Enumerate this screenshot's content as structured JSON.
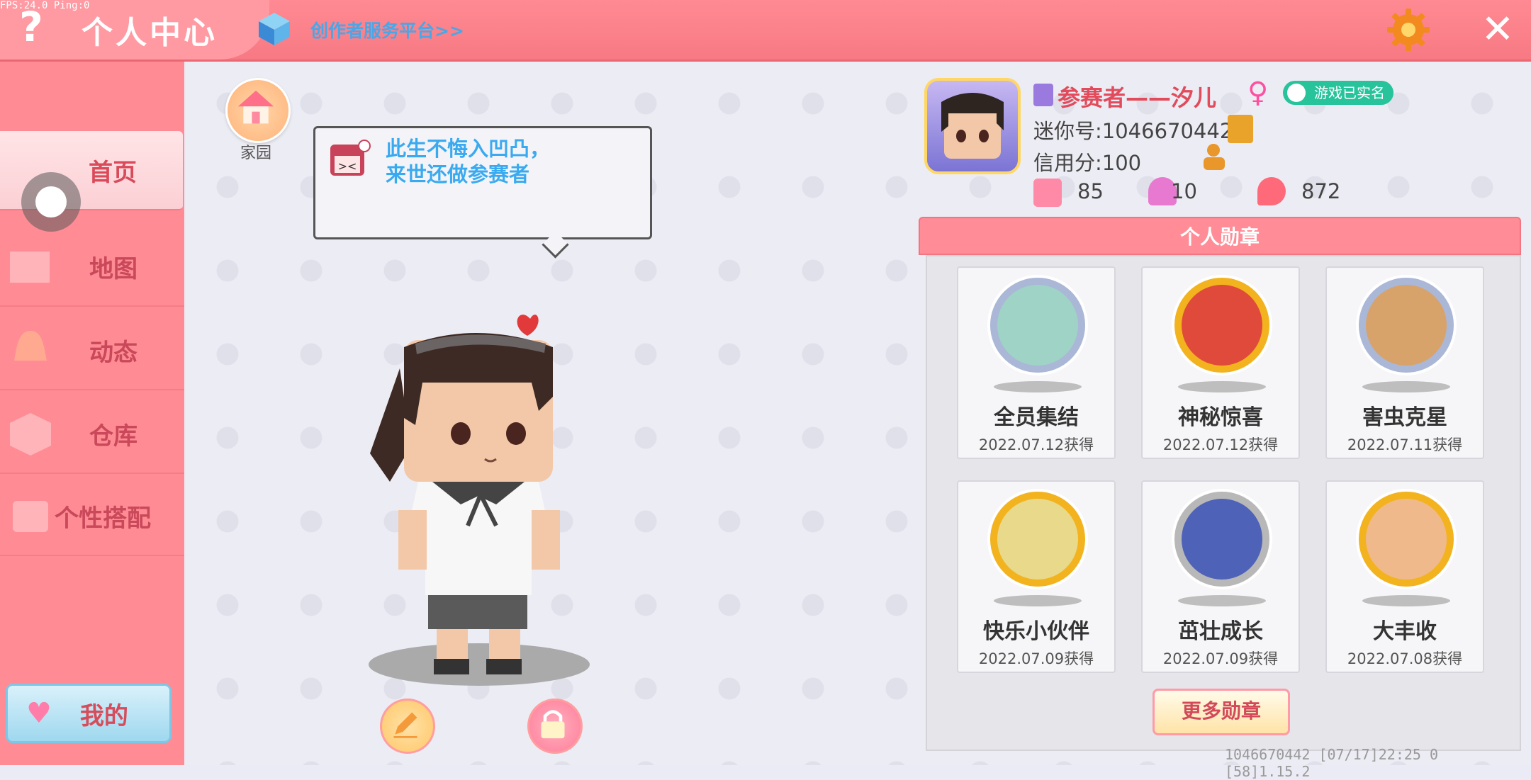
{
  "debug": {
    "fps": "FPS:24.0  Ping:0"
  },
  "header": {
    "title": "个人中心",
    "creator_link": "创作者服务平台>>",
    "help_icon": "question-icon",
    "close_icon": "close-icon",
    "settings_icon": "gear-icon"
  },
  "sidebar": {
    "items": [
      {
        "label": "首页",
        "active": true
      },
      {
        "label": "地图",
        "active": false
      },
      {
        "label": "动态",
        "active": false
      },
      {
        "label": "仓库",
        "active": false
      },
      {
        "label": "个性搭配",
        "active": false
      }
    ],
    "mine_label": "我的"
  },
  "home": {
    "label": "家园"
  },
  "bubble": {
    "text": "此生不悔入凹凸，来世还做参赛者"
  },
  "profile": {
    "name": "参赛者——汐儿",
    "gender": "♀",
    "realname_badge": "游戏已实名",
    "mini_id": "迷你号:1046670442",
    "credit": "信用分:100",
    "stats": [
      {
        "icon": "plus-card-icon",
        "value": "85"
      },
      {
        "icon": "trophy-person-icon",
        "value": "10"
      },
      {
        "icon": "flame-icon",
        "value": "872"
      }
    ]
  },
  "medals": {
    "title": "个人勋章",
    "items": [
      {
        "name": "全员集结",
        "date": "2022.07.12获得",
        "ring": "#aab7d6",
        "face": "#9fd3c6"
      },
      {
        "name": "神秘惊喜",
        "date": "2022.07.12获得",
        "ring": "#f2b31f",
        "face": "#e04a3a"
      },
      {
        "name": "害虫克星",
        "date": "2022.07.11获得",
        "ring": "#aab7d6",
        "face": "#d8a36a"
      },
      {
        "name": "快乐小伙伴",
        "date": "2022.07.09获得",
        "ring": "#f2b31f",
        "face": "#e9d98a"
      },
      {
        "name": "茁壮成长",
        "date": "2022.07.09获得",
        "ring": "#b8b8b8",
        "face": "#4e62b8"
      },
      {
        "name": "大丰收",
        "date": "2022.07.08获得",
        "ring": "#f2b31f",
        "face": "#f0b98c"
      }
    ],
    "more_label": "更多勋章"
  },
  "footer": {
    "text": "1046670442   [07/17]22:25 0   [58]1.15.2"
  }
}
